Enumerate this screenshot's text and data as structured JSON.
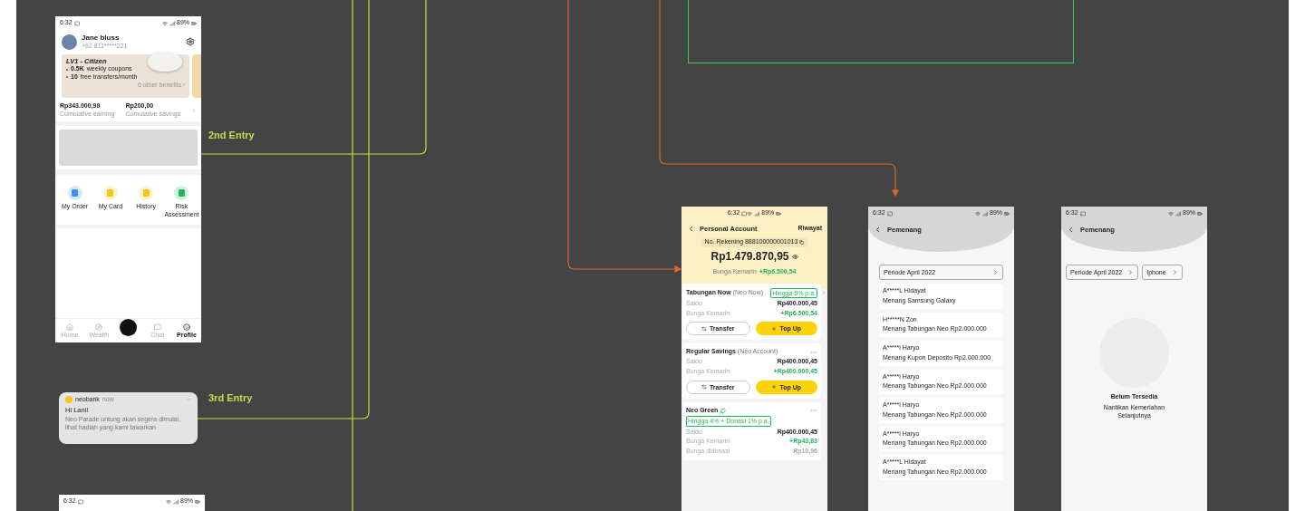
{
  "labels": [
    {
      "text": "2nd Entry"
    },
    {
      "text": "3rd Entry"
    }
  ],
  "profile_screen": {
    "status": {
      "time": "6:32",
      "battery": "89%"
    },
    "user": {
      "name": "Jane bluss",
      "phone": "+62 811*****221"
    },
    "level_card": {
      "title": "LV1 - Citizen",
      "benefits": [
        {
          "value": "0.5K",
          "label": "weekly coupons"
        },
        {
          "value": "10",
          "label": "free transfers/month"
        }
      ],
      "more": "6 other benefits ›"
    },
    "stats": [
      {
        "amount": "Rp343.000,99",
        "label": "Cumulative earning"
      },
      {
        "amount": "Rp200,00",
        "label": "Cumulative savings"
      }
    ],
    "shortcuts": [
      {
        "label": "My Order",
        "color": "#3d8ef0"
      },
      {
        "label": "My Card",
        "color": "#f5c518"
      },
      {
        "label": "History",
        "color": "#f5c518"
      },
      {
        "label": "Risk Assessment",
        "color": "#22b45a"
      }
    ],
    "nav": [
      {
        "label": "Home",
        "selected": false
      },
      {
        "label": "Wealth",
        "selected": false
      },
      {
        "label": "Chat",
        "selected": false
      },
      {
        "label": "Profile",
        "selected": true
      }
    ]
  },
  "notification": {
    "app": "neobank",
    "time": "now",
    "title": "Hi Lani!",
    "body": "Neo Parade untung akan segera dimulai, lihat hadiah yang kami tawarkan"
  },
  "partial_screen": {
    "status": {
      "time": "6:32",
      "battery": "89%"
    }
  },
  "account_screen": {
    "status": {
      "time": "6:32",
      "battery": "89%"
    },
    "title": "Personal Account",
    "action": "Riwayat",
    "account_number": "No. Rekening 888100000001013",
    "balance": "Rp1.479.870,95",
    "interest_label": "Bunga Kemarin",
    "interest_value": "+Rp6.500,54",
    "accounts": [
      {
        "name": "Tabungan Now",
        "sub": "(Neo Now)",
        "badge": "Hingga 5% p.a.",
        "kind": "expandable",
        "rows": [
          {
            "label": "Saldo",
            "value": "Rp400.000,45",
            "kind": "plain"
          },
          {
            "label": "Bunga Kemarin",
            "value": "+Rp6.500,54",
            "kind": "gain"
          }
        ],
        "buttons": [
          {
            "label": "Transfer",
            "kind": "outline"
          },
          {
            "label": "Top Up",
            "kind": "primary"
          }
        ]
      },
      {
        "name": "Regular Savings",
        "sub": "(Neo Account)",
        "kind": "menu",
        "rows": [
          {
            "label": "Saldo",
            "value": "Rp400.000,45",
            "kind": "plain"
          },
          {
            "label": "Bunga Kemarin",
            "value": "+Rp400.000,45",
            "kind": "gain"
          }
        ],
        "buttons": [
          {
            "label": "Transfer",
            "kind": "outline"
          },
          {
            "label": "Top Up",
            "kind": "primary"
          }
        ]
      },
      {
        "name": "Neo Green",
        "leaf": true,
        "badge": "Hingga 4% + Donasi 1% p.a.",
        "kind": "menu",
        "rows": [
          {
            "label": "Saldo",
            "value": "Rp400.000,45",
            "kind": "plain"
          },
          {
            "label": "Bunga Kemarin",
            "value": "+Rp43,83",
            "kind": "gain"
          },
          {
            "label": "Bunga didonasi",
            "value": "Rp10,96",
            "kind": "muted"
          }
        ]
      }
    ]
  },
  "winners_screen": {
    "status": {
      "time": "6:32",
      "battery": "89%"
    },
    "title": "Pemenang",
    "filters": [
      "Periode April 2022"
    ],
    "winners": [
      {
        "name": "A*****L Hidayat",
        "prize": "Menang Samsung Galaxy"
      },
      {
        "name": "H*****N Zon",
        "prize": "Menang Tabungan Neo Rp2.000.000"
      },
      {
        "name": "A*****i Haryo",
        "prize": "Menang Kupon Deposito Rp2.000.000"
      },
      {
        "name": "A*****i Haryo",
        "prize": "Menang Tabungan Neo Rp2.000.000"
      },
      {
        "name": "A*****i Haryo",
        "prize": "Menang Tabungan Neo Rp2.000.000"
      },
      {
        "name": "A*****i Haryo",
        "prize": "Menang Tabungan Neo Rp2.000.000"
      },
      {
        "name": "A*****L Hidayat",
        "prize": "Menang Tabungan Neo Rp2.000.000"
      }
    ]
  },
  "empty_screen": {
    "status": {
      "time": "6:32",
      "battery": "89%"
    },
    "title": "Pemenang",
    "filters": [
      "Periode April 2022",
      "Iphone"
    ],
    "empty_title": "Belum Tersedia",
    "empty_text": "Nantikan Kemeriahan Selanjutnya"
  }
}
